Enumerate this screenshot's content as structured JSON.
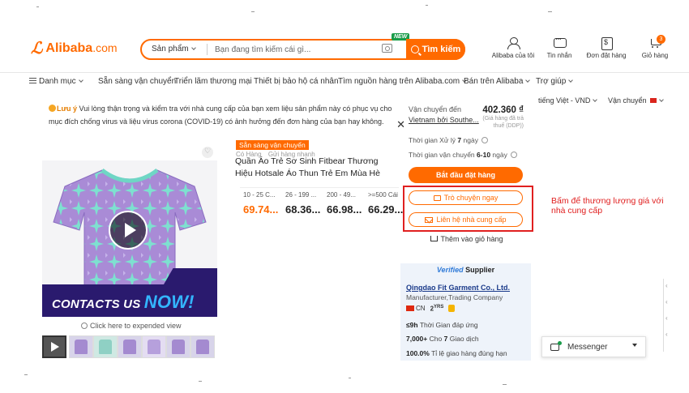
{
  "header": {
    "logo_text": "Alibaba",
    "logo_suffix": ".com",
    "search": {
      "category": "Sản phẩm",
      "placeholder": "Bạn đang tìm kiếm cái gì...",
      "button_label": "Tìm kiếm",
      "new_badge": "NEW"
    },
    "nav": [
      {
        "label": "Alibaba của tôi",
        "icon": "user-icon"
      },
      {
        "label": "Tin nhắn",
        "icon": "message-icon"
      },
      {
        "label": "Đơn đặt hàng",
        "icon": "order-icon"
      },
      {
        "label": "Giỏ hàng",
        "icon": "cart-icon"
      }
    ],
    "cart_count": "3"
  },
  "catnav": {
    "categories": "Danh mục",
    "items": [
      "Sẵn sàng vận chuyển",
      "Triển lãm thương mại",
      "Thiết bị bảo hộ cá nhân",
      "Tìm nguồn hàng trên Alibaba.com",
      "Bán trên Alibaba",
      "Trợ giúp"
    ]
  },
  "notice": {
    "badge": "Lưu ý",
    "text": "Vui lòng thận trọng và kiểm tra với nhà cung cấp của bạn xem liệu sản phẩm này có phục vụ cho mục đích chống virus và liệu virus corona (COVID-19) có ảnh hưởng đến đơn hàng của bạn hay không."
  },
  "product": {
    "ready_tag": "Sẵn sàng vận chuyển",
    "sub_tag_1": "Có Hàng",
    "sub_tag_2": "Gửi hàng nhanh",
    "title": "Quần Áo Trẻ Sơ Sinh Fitbear Thương Hiệu Hotsale Áo Thun Trẻ Em Mùa Hè",
    "banner_text": "CONTACTS US",
    "banner_now": "NOW!",
    "expand_link": "Click here to expended view",
    "tiers": [
      {
        "qty": "10 - 25 C...",
        "price": "69.74..."
      },
      {
        "qty": "26 - 199 ...",
        "price": "68.36..."
      },
      {
        "qty": "200 - 49...",
        "price": "66.98..."
      },
      {
        "qty": ">=500 Cái",
        "price": "66.29..."
      }
    ]
  },
  "panel": {
    "shipping_label": "Vận chuyển đến",
    "shipping_price": "402.360 ₫",
    "shipping_method": "Vietnam bởi Southe...",
    "shipping_note": "(Giá hàng đã trả thuế (DDP))",
    "processing_label": "Thời gian Xử lý",
    "processing_value": "7",
    "processing_unit": "ngày",
    "ship_time_label": "Thời gian vận chuyển",
    "ship_time_value": "6-10",
    "ship_time_unit": "ngày",
    "order_button": "Bắt đầu đặt hàng",
    "chat_button": "Trò chuyện ngay",
    "contact_button": "Liên hệ nhà cung cấp",
    "add_to_cart": "Thêm vào giỏ hàng"
  },
  "annotation": "Bấm để thương lượng giá với nhà cung cấp",
  "supplier": {
    "verified_prefix": "Verified",
    "verified_suffix": "Supplier",
    "name": "Qingdao Fit Garment Co., Ltd.",
    "type": "Manufacturer,Trading Company",
    "country": "CN",
    "years": "2",
    "years_suffix": "YRS",
    "response_time": "≤9h",
    "response_label": "Thời Gian đáp ứng",
    "transactions": "7,000+",
    "transactions_label": "Cho",
    "transactions_count": "7",
    "transactions_suffix": "Giao dịch",
    "delivery_rate": "100.0%",
    "delivery_label": "Tỉ lệ giao hàng đúng hạn"
  },
  "topright": {
    "language": "tiếng Việt - VND",
    "ship_to": "Vận chuyển"
  },
  "messenger": {
    "label": "Messenger"
  },
  "colors": {
    "accent": "#ff6a00",
    "annotation": "#e02020",
    "verified": "#2f7ad8"
  }
}
